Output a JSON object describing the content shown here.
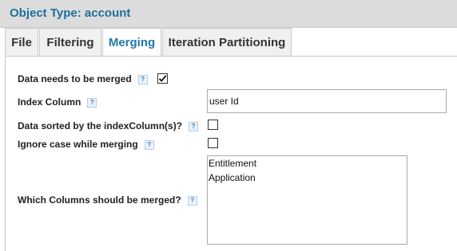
{
  "header": {
    "title": "Object Type: account"
  },
  "tabs": [
    {
      "label": "File",
      "active": false
    },
    {
      "label": "Filtering",
      "active": false
    },
    {
      "label": "Merging",
      "active": true
    },
    {
      "label": "Iteration Partitioning",
      "active": false
    }
  ],
  "help_glyph": "?",
  "form": {
    "needs_merge": {
      "label": "Data needs to be merged",
      "checked": true
    },
    "index_column": {
      "label": "Index Column",
      "value": "user Id"
    },
    "sorted": {
      "label": "Data sorted by the indexColumn(s)?",
      "checked": false
    },
    "ignore_case": {
      "label": "Ignore case while merging",
      "checked": false
    },
    "merge_columns": {
      "label": "Which Columns should be merged?",
      "options": [
        "Entitlement",
        "Application"
      ]
    }
  },
  "colors": {
    "accent": "#1f6f9c",
    "header_bg": "#dcdcdc"
  }
}
